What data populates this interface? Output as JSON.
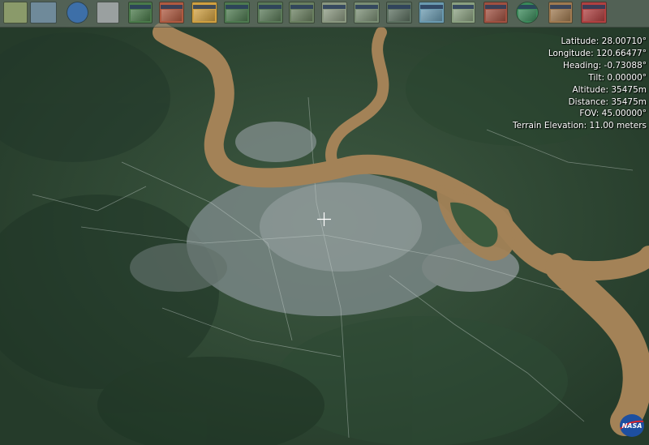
{
  "toolbar": {
    "buttons": [
      {
        "name": "layers-icon",
        "color": "#8a9a6a"
      },
      {
        "name": "grid-icon",
        "color": "#6f8a9a"
      },
      {
        "name": "globe-icon",
        "color": "#3d6fa8"
      },
      {
        "name": "search-icon",
        "color": "#9aa0a0"
      },
      {
        "name": "blue-marble-layer",
        "color": "#4a7a4a"
      },
      {
        "name": "modis-layer",
        "color": "#b05a40"
      },
      {
        "name": "elevation-layer",
        "color": "#d0a040"
      },
      {
        "name": "landsat-layer",
        "color": "#4e7a50"
      },
      {
        "name": "landsat-true-color-layer",
        "color": "#5a7a58"
      },
      {
        "name": "landsat-false-color-layer",
        "color": "#6a8060"
      },
      {
        "name": "usgs-topo-layer",
        "color": "#8a9880"
      },
      {
        "name": "usgs-urban-layer",
        "color": "#7a8e74"
      },
      {
        "name": "usgs-imagery-layer",
        "color": "#5c7060"
      },
      {
        "name": "satellite-layer",
        "color": "#6a9ab0"
      },
      {
        "name": "photo-layer",
        "color": "#8aa080"
      },
      {
        "name": "placenames-layer",
        "color": "#a05040"
      },
      {
        "name": "landmark-layer",
        "color": "#3a8a5a"
      },
      {
        "name": "boundaries-layer",
        "color": "#a07a50"
      },
      {
        "name": "flags-layer",
        "color": "#b04040"
      }
    ]
  },
  "readout": {
    "latitude": "Latitude: 28.00710°",
    "longitude": "Longitude: 120.66477°",
    "heading": "Heading: -0.73088°",
    "tilt": "Tilt: 0.00000°",
    "altitude": "Altitude: 35475m",
    "distance": "Distance: 35475m",
    "fov": "FOV: 45.00000°",
    "terrain_elevation": "Terrain Elevation: 11.00 meters"
  },
  "logo": {
    "text": "NASA",
    "color": "#1d4fa0"
  },
  "colors": {
    "river": "#a38257",
    "terrain": "#2f4a34",
    "city": "#8a8f94"
  }
}
